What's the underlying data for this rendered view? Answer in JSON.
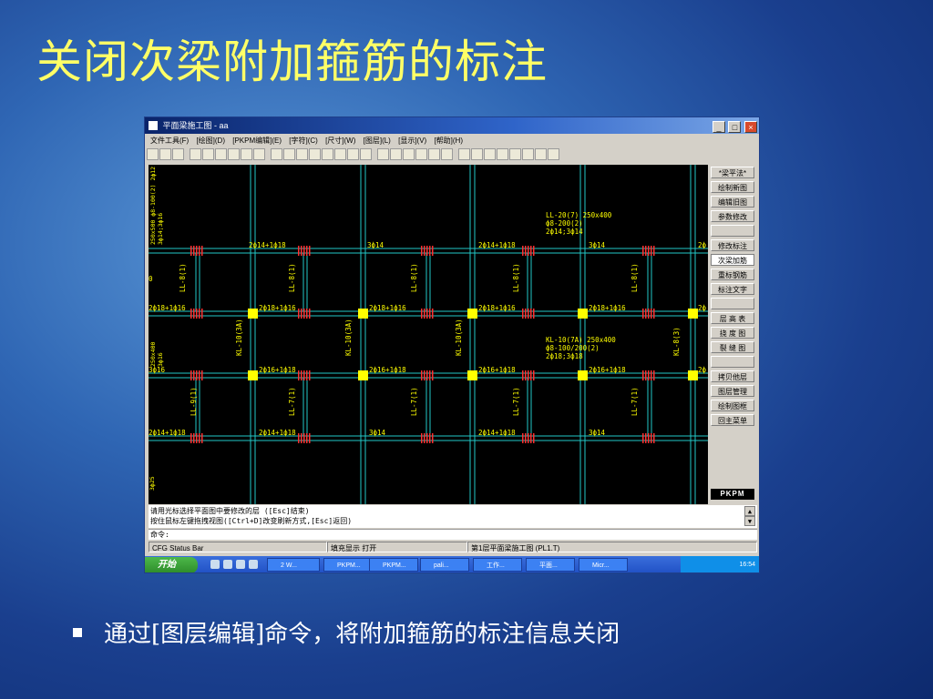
{
  "slide": {
    "title": "关闭次梁附加箍筋的标注",
    "bullet": "通过[图层编辑]命令，将附加箍筋的标注信息关闭"
  },
  "window": {
    "title": "平面梁施工图 - aa",
    "controls": [
      "_",
      "□",
      "×"
    ]
  },
  "menu": [
    "文件工具(F)",
    "[绘图](D)",
    "[PKPM编辑](E)",
    "[字符](C)",
    "[尺寸](W)",
    "[图层](L)",
    "[显示](V)",
    "[帮助](H)"
  ],
  "drawing": {
    "top_labels": [
      "2ф14+1ф18",
      "3ф14",
      "2ф14+1ф18",
      "3ф14",
      "2ф"
    ],
    "mid_labels": [
      "2ф18+1ф16",
      "2ф18+1ф16",
      "2ф18+1ф16",
      "2ф18+1ф16",
      "2ф18+1ф16",
      "2ф"
    ],
    "lower_labels": [
      "3ф16",
      "2ф16+1ф18",
      "2ф16+1ф18",
      "2ф16+1ф18",
      "2ф16+1ф18",
      "2ф"
    ],
    "bottom_labels": [
      "2ф14+1ф18",
      "2ф14+1ф18",
      "3ф14",
      "2ф14+1ф18",
      "3ф14"
    ],
    "beam_ids_row1": [
      "LL-8(1)",
      "LL-8(1)",
      "LL-8(1)",
      "LL-8(1)",
      "LL-8(1)"
    ],
    "beam_ids_row2": [
      "KL-10(3A)",
      "KL-10(3A)",
      "KL-10(3A)",
      "KL-8(3)"
    ],
    "beam_ids_row3": [
      "LL-9(1)",
      "LL-7(1)",
      "LL-7(1)",
      "LL-7(1)",
      "LL-7(1)"
    ],
    "beam_note_1": [
      "LL-20(7) 250x400",
      "ф8-200(2)",
      "2ф14;3ф14"
    ],
    "beam_note_2": [
      "KL-10(7A) 250x400",
      "ф8-100/200(2)",
      "2ф18;3ф18"
    ],
    "left_vert_1": "250x500  ф8-100(2)  2ф12",
    "left_vert_2": "3ф14;3ф16",
    "left_vert_3": "250x400",
    "left_vert_4": "3ф16",
    "left_vert_5": "3ф25",
    "left_zero": "0"
  },
  "right_panel": [
    {
      "label": "*梁平法*",
      "selected": false
    },
    {
      "label": "绘制新图",
      "selected": false
    },
    {
      "label": "编辑旧图",
      "selected": false
    },
    {
      "label": "参数修改",
      "selected": false
    },
    {
      "label": "",
      "selected": false
    },
    {
      "label": "修改标注",
      "selected": false
    },
    {
      "label": "次梁加筋",
      "selected": true
    },
    {
      "label": "重标钢筋",
      "selected": false
    },
    {
      "label": "标注文字",
      "selected": false
    },
    {
      "label": "",
      "selected": false
    },
    {
      "label": "层 高 表",
      "selected": false
    },
    {
      "label": "挠 度 图",
      "selected": false
    },
    {
      "label": "裂 缝 图",
      "selected": false
    },
    {
      "label": "",
      "selected": false
    },
    {
      "label": "拷贝他层",
      "selected": false
    },
    {
      "label": "图层管理",
      "selected": false
    },
    {
      "label": "绘制图框",
      "selected": false
    },
    {
      "label": "回主菜单",
      "selected": false
    }
  ],
  "pkpm_logo": "PKPM",
  "command": {
    "line1": "请用光标选择平面图中要修改的层 ([Esc]结束)",
    "line2": "按住鼠标左键拖拽视图([Ctrl+D]改变刷新方式,[Esc]返回)",
    "prompt": "命令:"
  },
  "status": {
    "left": "CFG Status Bar",
    "fill": "填充显示 打开",
    "layer": "第1层平面梁施工图 (PL1.T)"
  },
  "taskbar": {
    "start": "开始",
    "tasks": [
      "2 W...",
      "PKPM...",
      "PKPM...",
      "pali...",
      "工作...",
      "平面...",
      "Micr..."
    ],
    "time": "16:54"
  },
  "colors": {
    "title_yellow": "#ffff66",
    "grid_cyan": "#22c8c8",
    "text_yellow": "#ffff00",
    "column_yellow": "#ffff00",
    "rebar_red": "#ff3030"
  }
}
